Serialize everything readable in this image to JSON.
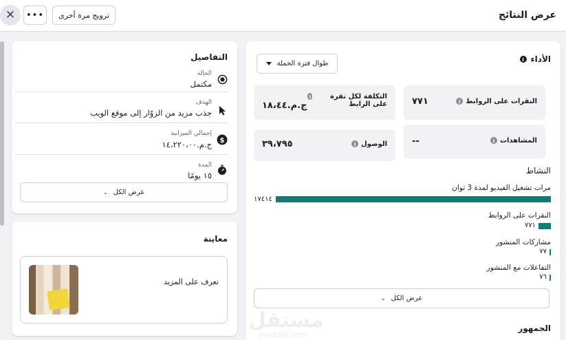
{
  "header": {
    "title": "عرض النتائج",
    "promote_again_label": "ترويج مرة أخرى",
    "more_label": "•••",
    "close_label": "✕"
  },
  "details": {
    "title": "التفاصيل",
    "status": {
      "label": "الحالة",
      "value": "مكتمل",
      "icon": "radio-icon"
    },
    "goal": {
      "label": "الهدف",
      "value": "جذب مزيد من الزوّار إلى موقع الويب",
      "icon": "cursor-icon"
    },
    "budget": {
      "label": "إجمالي الميزانية",
      "value": "ج.م.١٤،٢٢٠،٠٠",
      "icon": "dollar-icon"
    },
    "duration": {
      "label": "المدة",
      "value": "١٥ يومًا",
      "icon": "stopwatch-icon"
    },
    "show_all_label": "عرض الكل"
  },
  "preview": {
    "title": "معاينة",
    "ad_text": "تعرف على المزيد"
  },
  "performance": {
    "title": "الأداء",
    "period_label": "طوال فترة الحملة",
    "metrics": {
      "link_clicks": {
        "label": "النقرات على الروابط",
        "value": "٧٧١"
      },
      "cost_per_click": {
        "label": "التكلفة لكل نقرة على الرابط",
        "value": "ج.م.١٨،٤٤"
      },
      "views": {
        "label": "المشاهدات",
        "value": "--"
      },
      "reach": {
        "label": "الوصول",
        "value": "٣٩،٧٩٥"
      }
    }
  },
  "activity": {
    "title": "النشاط",
    "items": [
      {
        "label": "مرات تشغيل الفيديو لمدة 3 ثوان",
        "value": "١٧٤١٤",
        "fraction": 1.0
      },
      {
        "label": "النقرات على الروابط",
        "value": "٧٧١",
        "fraction": 0.044
      },
      {
        "label": "مشاركات المنشور",
        "value": "٧٧",
        "fraction": 0.0044
      },
      {
        "label": "التفاعلات مع المنشور",
        "value": "٧٦",
        "fraction": 0.0044
      }
    ],
    "show_all_label": "عرض الكل"
  },
  "audience": {
    "title": "الجمهور"
  },
  "watermark": {
    "text": "مستقل",
    "url": "mostaql.com"
  },
  "colors": {
    "accent": "#0f7c78",
    "page_bg": "#f0f2f5",
    "metric_bg": "#f0f2f5"
  }
}
